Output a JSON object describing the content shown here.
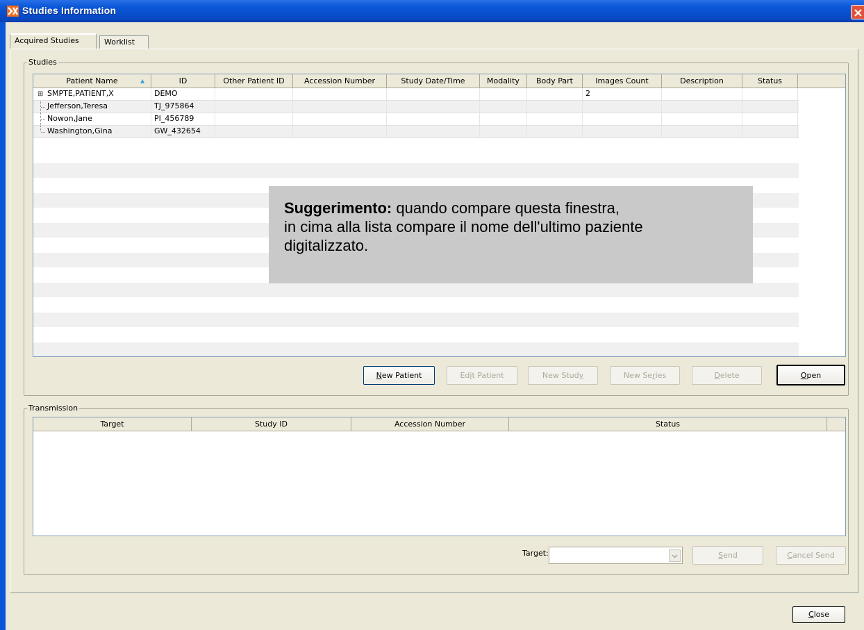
{
  "window": {
    "title": "Studies Information"
  },
  "tabs": [
    {
      "label": "Acquired Studies",
      "active": true
    },
    {
      "label": "Worklist",
      "active": false
    }
  ],
  "studies": {
    "group_label": "Studies",
    "columns": [
      "Patient Name",
      "ID",
      "Other Patient ID",
      "Accession Number",
      "Study Date/Time",
      "Modality",
      "Body Part",
      "Images Count",
      "Description",
      "Status"
    ],
    "sort_indicator": "▲",
    "rows": [
      {
        "name": "SMPTE,PATIENT,X",
        "id": "DEMO",
        "other_id": "",
        "accession": "",
        "study_date": "",
        "modality": "",
        "body_part": "",
        "images": "2",
        "description": "",
        "status": "",
        "expander": "⊞"
      },
      {
        "name": "Jefferson,Teresa",
        "id": "TJ_975864",
        "other_id": "",
        "accession": "",
        "study_date": "",
        "modality": "",
        "body_part": "",
        "images": "",
        "description": "",
        "status": ""
      },
      {
        "name": "Nowon,Jane",
        "id": "PI_456789",
        "other_id": "",
        "accession": "",
        "study_date": "",
        "modality": "",
        "body_part": "",
        "images": "",
        "description": "",
        "status": ""
      },
      {
        "name": "Washington,Gina",
        "id": "GW_432654",
        "other_id": "",
        "accession": "",
        "study_date": "",
        "modality": "",
        "body_part": "",
        "images": "",
        "description": "",
        "status": ""
      }
    ],
    "buttons": {
      "new_patient": {
        "pre": "",
        "key": "N",
        "post": "ew Patient"
      },
      "edit_patient": {
        "pre": "Ed",
        "key": "i",
        "post": "t Patient"
      },
      "new_study": {
        "pre": "New Stud",
        "key": "y",
        "post": ""
      },
      "new_series": {
        "pre": "New Se",
        "key": "r",
        "post": "ies"
      },
      "delete": {
        "pre": "",
        "key": "D",
        "post": "elete"
      },
      "open": {
        "pre": "",
        "key": "O",
        "post": "pen"
      }
    }
  },
  "tooltip": {
    "bold": "Suggerimento:",
    "line1": " quando compare questa finestra,",
    "line2": "in cima alla lista compare il nome dell'ultimo paziente",
    "line3": "digitalizzato."
  },
  "transmission": {
    "group_label": "Transmission",
    "columns": [
      "Target",
      "Study ID",
      "Accession Number",
      "Status"
    ],
    "target_label": "Target:",
    "target_value": "",
    "buttons": {
      "send": {
        "pre": "",
        "key": "S",
        "post": "end"
      },
      "cancel_send": {
        "pre": "",
        "key": "C",
        "post": "ancel Send"
      }
    }
  },
  "footer": {
    "close": {
      "pre": "",
      "key": "C",
      "post": "lose"
    }
  },
  "colors": {
    "titlebar": "#0a58d8",
    "dialog": "#ece9d8",
    "close": "#e0533a",
    "accent_sort": "#3aa0d8"
  }
}
